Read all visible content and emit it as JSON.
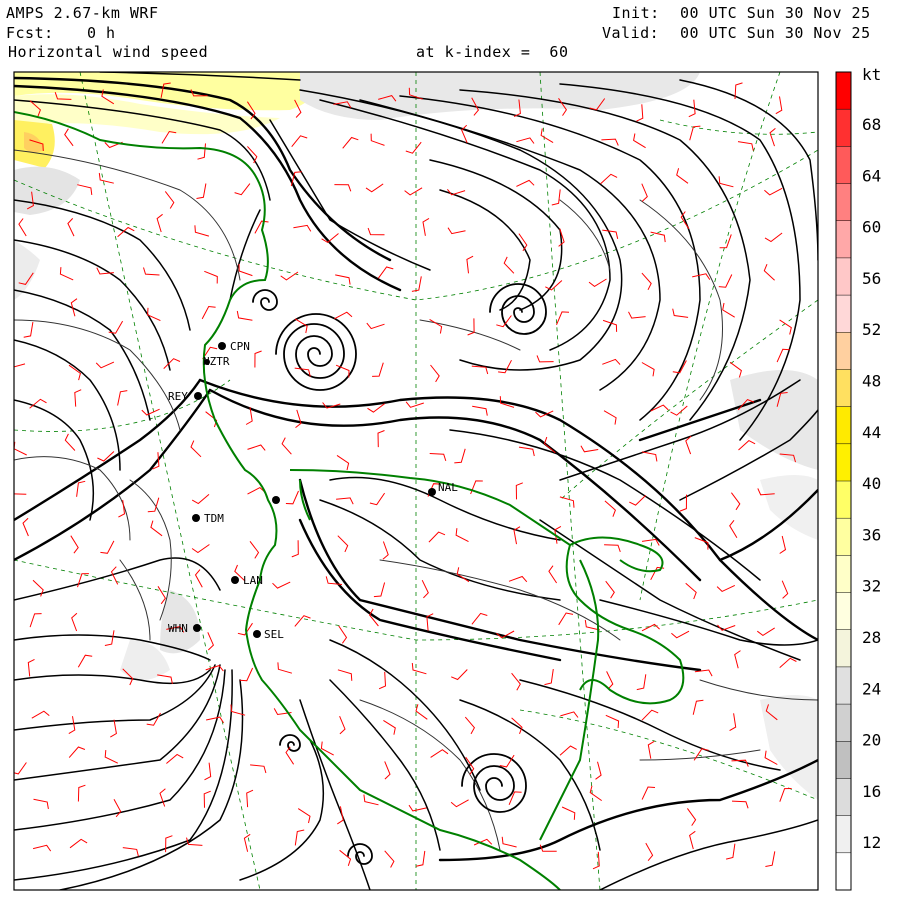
{
  "header": {
    "model": "AMPS 2.67-km WRF",
    "fcst_label": "Fcst:",
    "fcst_value": "0 h",
    "field": "Horizontal wind speed",
    "level": "at k-index =  60",
    "init_label": "Init:",
    "init_value": "00 UTC Sun 30 Nov 25",
    "valid_label": "Valid:",
    "valid_value": "00 UTC Sun 30 Nov 25"
  },
  "colorbar": {
    "unit": "kt",
    "labels": [
      "68",
      "64",
      "60",
      "56",
      "52",
      "48",
      "44",
      "40",
      "36",
      "32",
      "28",
      "24",
      "20",
      "16",
      "12"
    ],
    "colors": [
      "#ff0000",
      "#ff3030",
      "#ff5a5a",
      "#ff8080",
      "#ffa8a8",
      "#ffc8c8",
      "#ffd8d8",
      "#ffd0a0",
      "#ffe060",
      "#ffea00",
      "#fff000",
      "#ffff66",
      "#ffffa0",
      "#ffffc8",
      "#ffffe0",
      "#f4f4dc",
      "#e0e0e0",
      "#d0d0d0",
      "#c0c0c0",
      "#dcdcdc",
      "#f0f0f0",
      "#ffffff"
    ]
  },
  "stations": [
    {
      "id": "CPN",
      "label": "CPN"
    },
    {
      "id": "NZTR",
      "label": "NZTR"
    },
    {
      "id": "REY",
      "label": "REY"
    },
    {
      "id": "NAL",
      "label": "NAL"
    },
    {
      "id": "TDM",
      "label": "TDM"
    },
    {
      "id": "LAN",
      "label": "LAN"
    },
    {
      "id": "WHN",
      "label": "WHN"
    },
    {
      "id": "SEL",
      "label": "SEL"
    }
  ],
  "style": {
    "streamline_color": "#000000",
    "barb_color": "#ff0000",
    "coast_color": "#008000",
    "grid_color": "#008000"
  }
}
